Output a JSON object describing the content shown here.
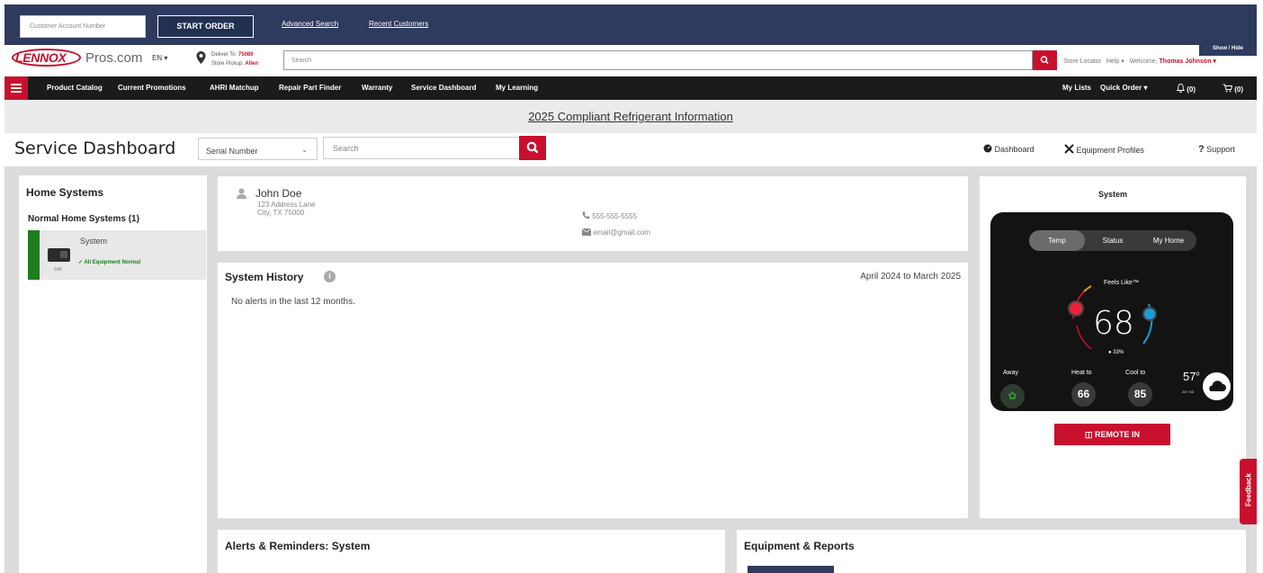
{
  "order_bar": {
    "account_placeholder": "Customer Account Number",
    "start_order_label": "START ORDER",
    "advanced_search_label": "Advanced Search",
    "recent_customers_label": "Recent Customers"
  },
  "brand": {
    "logo_text": "LENNOX",
    "site_name": "Pros.com",
    "language": "EN ▾",
    "deliver_to_label": "Deliver To:",
    "deliver_to_value": "75080",
    "store_pickup_label": "Store Pickup:",
    "store_pickup_value": "Allen",
    "search_placeholder": "Search",
    "store_locator": "Store Locator",
    "help": "Help ▾",
    "welcome": "Welcome,",
    "user_name": "Thomas Johnson ▾",
    "show_hide": "Show / Hide"
  },
  "nav": {
    "items": [
      "Product Catalog",
      "Current Promotions",
      "AHRI Matchup",
      "Repair Part Finder",
      "Warranty",
      "Service Dashboard",
      "My Learning"
    ],
    "my_lists": "My Lists",
    "quick_order": "Quick Order ▾",
    "notifications": "(0)",
    "cart": "(0)"
  },
  "banner": {
    "text": "2025 Compliant Refrigerant Information"
  },
  "dashboard": {
    "title": "Service Dashboard",
    "search_type": "Serial Number",
    "search_placeholder": "Search",
    "links": {
      "dashboard": "Dashboard",
      "equipment_profiles": "Equipment Profiles",
      "support": "Support"
    }
  },
  "home_systems": {
    "title": "Home Systems",
    "subtitle": "Normal Home Systems (1)",
    "items": [
      {
        "name": "System",
        "model": "S40",
        "status": "✓ All Equipment Normal",
        "status_color": "#1e7d1e"
      }
    ]
  },
  "customer": {
    "name": "John Doe",
    "address_line1": "123 Address Lane",
    "address_line2": "City, TX 75000",
    "phone": "555-555-5555",
    "email": "email@gmail.com"
  },
  "system_history": {
    "title": "System History",
    "range": "April 2024 to March 2025",
    "empty_message": "No alerts in the last 12 months."
  },
  "system_panel": {
    "title": "System",
    "tabs": [
      "Temp",
      "Status",
      "My Home"
    ],
    "active_tab": "Temp",
    "feels_like": "Feels Like™",
    "temperature": "68",
    "humidity": "33%",
    "away_label": "Away",
    "heat_label": "Heat to",
    "heat_value": "66",
    "cool_label": "Cool to",
    "cool_value": "85",
    "outdoor_temp": "57",
    "outdoor_sub": "↓53 ↑63",
    "remote_in_label": "REMOTE IN"
  },
  "alerts_panel": {
    "title": "Alerts & Reminders: System"
  },
  "equipment_panel": {
    "title": "Equipment & Reports"
  },
  "feedback_label": "Feedback",
  "colors": {
    "brand_red": "#c8102e",
    "navy": "#2e3b5e",
    "status_green": "#1e7d1e"
  }
}
